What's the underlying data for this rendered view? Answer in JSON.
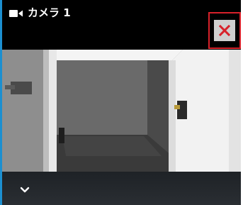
{
  "window": {
    "title": "カメラ 1",
    "title_icon": "video-camera-icon"
  },
  "controls": {
    "close_icon": "close-icon",
    "close_color": "#d8212a",
    "expand_icon": "chevron-down-icon"
  },
  "colors": {
    "accent": "#1c8fd0",
    "title_bar": "#000000",
    "bottom_bar": "#23272b"
  }
}
